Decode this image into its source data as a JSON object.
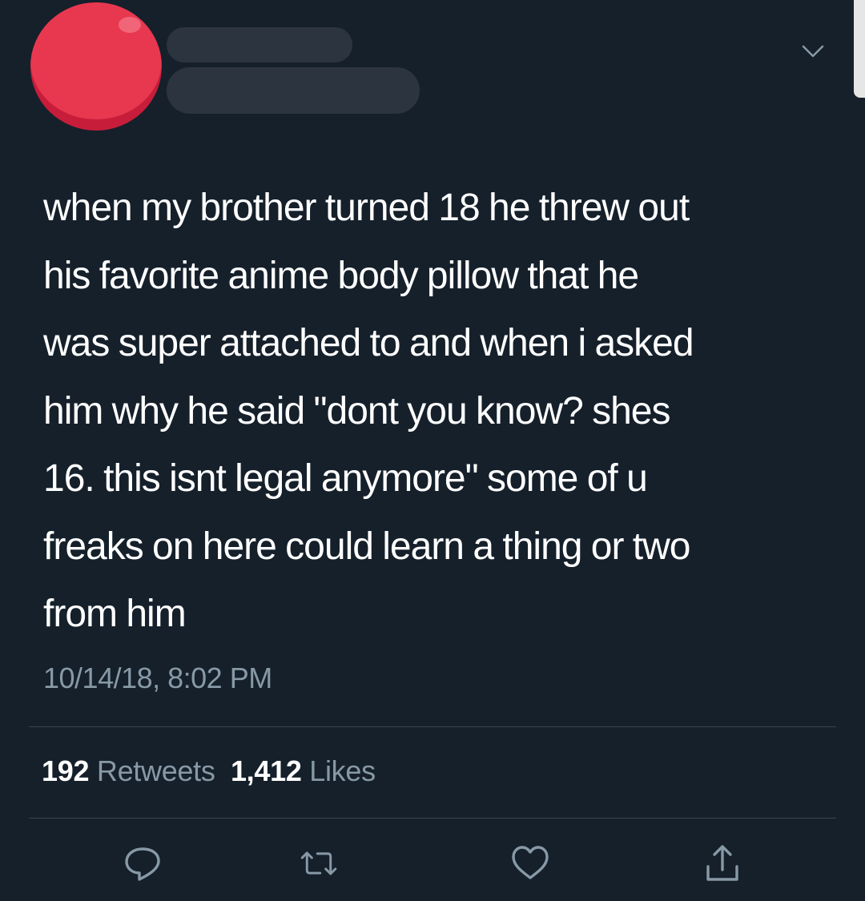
{
  "tweet": {
    "text": "when my brother turned 18 he threw out\nhis favorite anime body pillow that he\nwas super attached to and when i asked\nhim why he said \"dont you know? shes\n16. this isnt legal anymore\" some of u\nfreaks on here could learn a thing or two\nfrom him",
    "timestamp": "10/14/18, 8:02 PM"
  },
  "stats": {
    "retweets_count": "192",
    "retweets_label": "Retweets",
    "likes_count": "1,412",
    "likes_label": "Likes"
  },
  "actions": [
    {
      "icon": "reply-icon"
    },
    {
      "icon": "retweet-icon"
    },
    {
      "icon": "like-icon"
    },
    {
      "icon": "share-icon"
    }
  ],
  "colors": {
    "background": "#15202b",
    "text": "#ffffff",
    "secondary": "#8899a6",
    "divider": "#38444d",
    "avatar": "#e8384f"
  }
}
